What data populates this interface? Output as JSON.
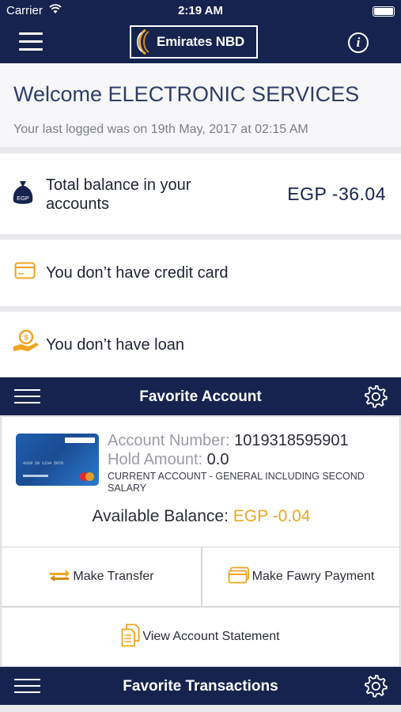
{
  "status_bar": {
    "carrier": "Carrier",
    "time": "2:19 AM"
  },
  "header": {
    "logo_text": "Emirates NBD"
  },
  "welcome": {
    "title": "Welcome ELECTRONIC SERVICES",
    "last_login": "Your last logged was on 19th May, 2017 at 02:15 AM"
  },
  "balance": {
    "label_line1": "Total balance in your",
    "label_line2": "accounts",
    "icon_label": "EGP",
    "amount": "EGP -36.04"
  },
  "credit_card": {
    "text": "You don’t have credit card"
  },
  "loan": {
    "text": "You don’t have loan"
  },
  "favorite_account": {
    "title": "Favorite Account",
    "card_number_text": "4329 20 1234 5678",
    "account_number_label": "Account Number:",
    "account_number": "1019318595901",
    "hold_amount_label": "Hold Amount:",
    "hold_amount": "0.0",
    "account_type": "CURRENT ACCOUNT - GENERAL INCLUDING SECOND SALARY",
    "available_balance_label": "Available Balance:",
    "available_balance": "EGP -0.04"
  },
  "actions": {
    "make_transfer": "Make Transfer",
    "make_fawry_payment": "Make Fawry Payment",
    "view_account_statement": "View Account Statement"
  },
  "favorite_transactions": {
    "title": "Favorite Transactions"
  },
  "colors": {
    "navy": "#16234e",
    "accent_orange": "#f0a522",
    "title_blue": "#2e3e68"
  },
  "icons": [
    "menu-icon",
    "info-icon",
    "money-bag-icon",
    "credit-card-icon",
    "loan-icon",
    "list-icon",
    "gear-icon",
    "transfer-icon",
    "fawry-card-icon",
    "statement-icon"
  ]
}
